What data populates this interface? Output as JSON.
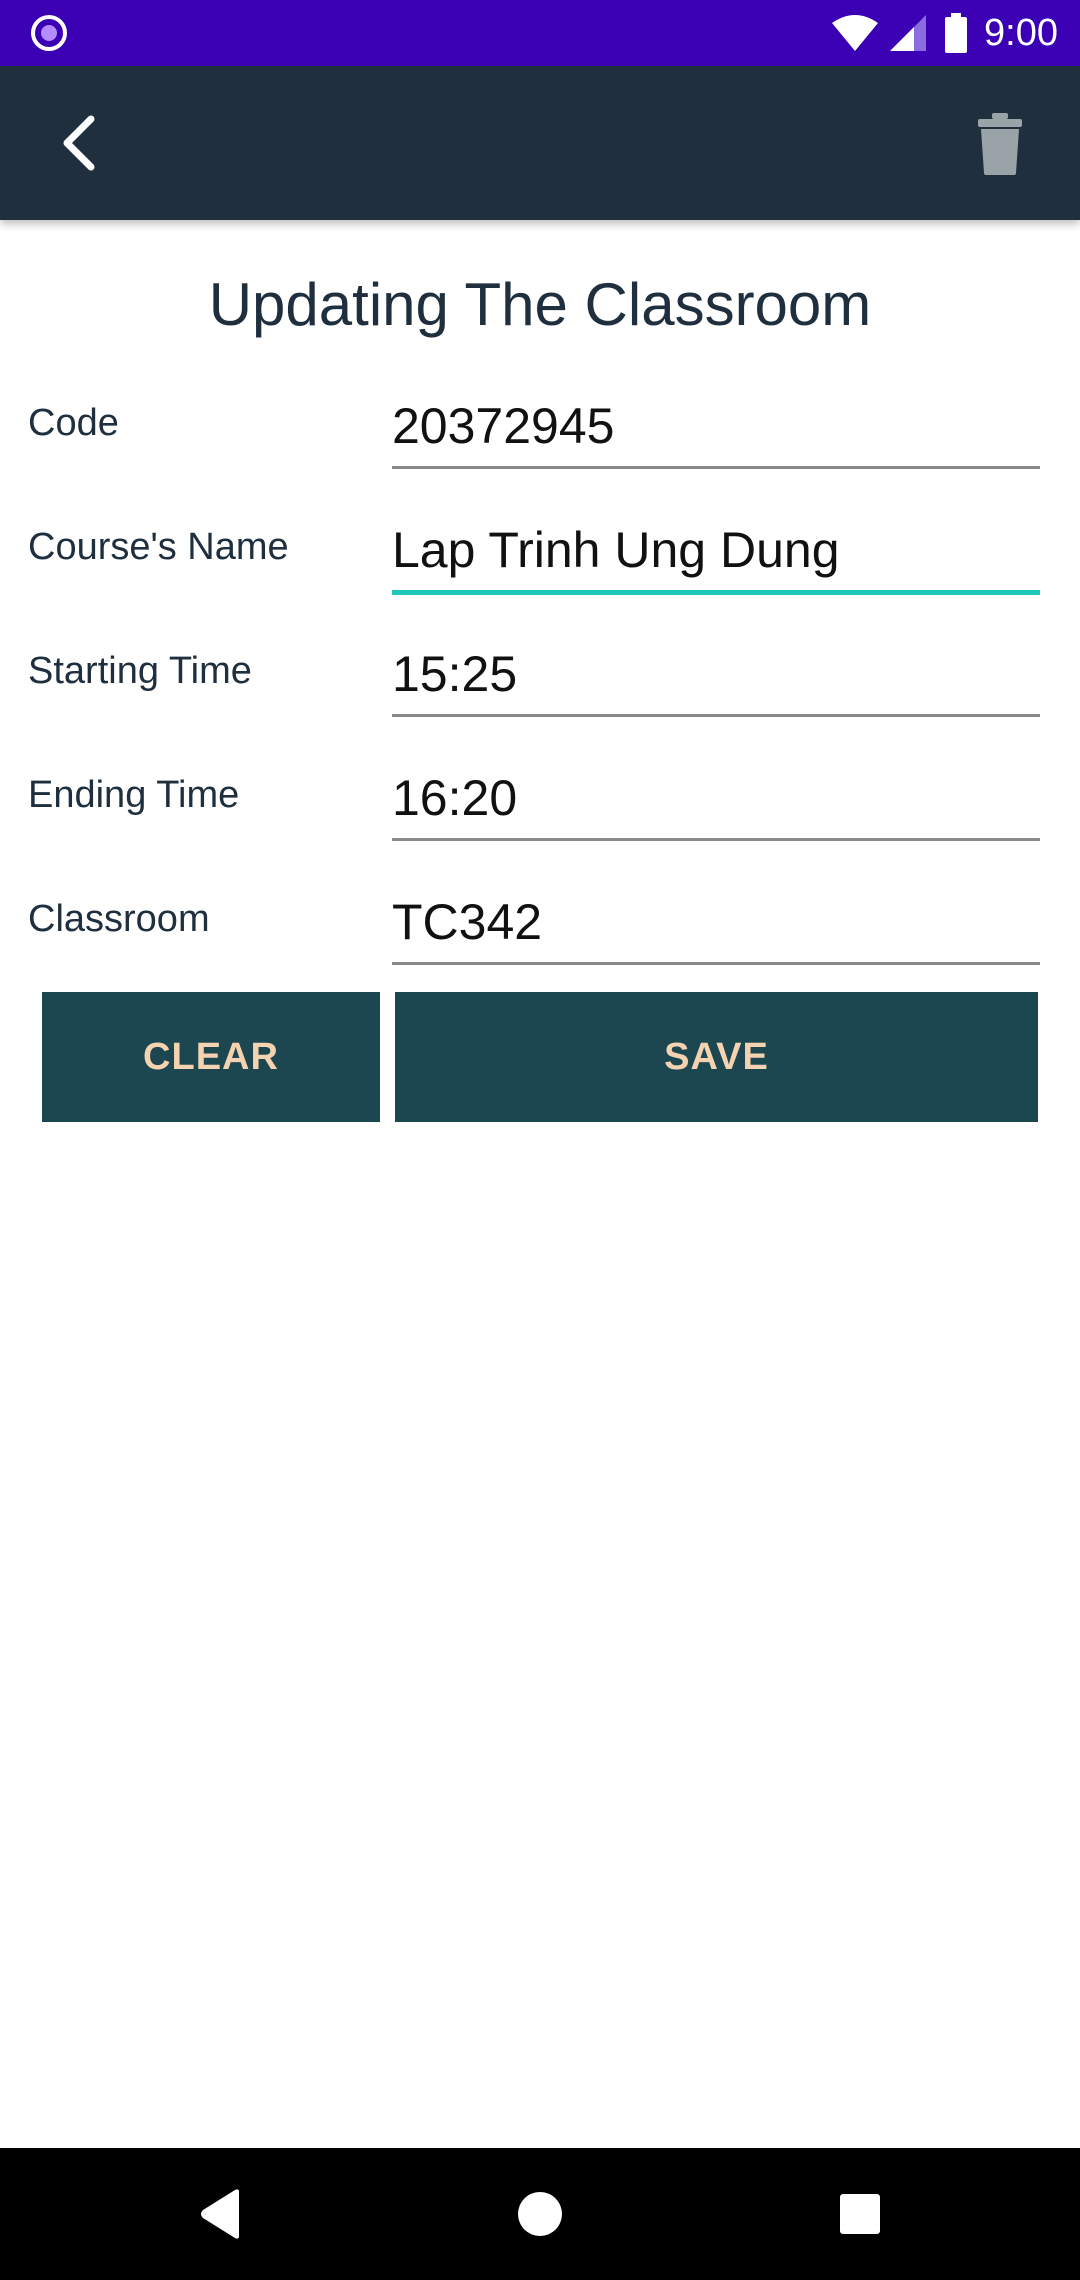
{
  "status_bar": {
    "time": "9:00",
    "icons": [
      "notification-dot-icon",
      "wifi-icon",
      "cell-signal-icon",
      "battery-icon"
    ],
    "background": "#3b00b4"
  },
  "app_bar": {
    "back_icon": "chevron-left-icon",
    "delete_icon": "trash-icon",
    "background": "#1f2f3d"
  },
  "page": {
    "title": "Updating The Classroom"
  },
  "form": {
    "fields": [
      {
        "label": "Code",
        "value": "20372945"
      },
      {
        "label": "Course's Name",
        "value": "Lap Trinh Ung Dung"
      },
      {
        "label": "Starting Time",
        "value": "15:25"
      },
      {
        "label": "Ending Time",
        "value": "16:20"
      },
      {
        "label": "Classroom",
        "value": "TC342"
      }
    ],
    "focused_field": "Course's Name",
    "accent_color": "#1fc7b6"
  },
  "actions": {
    "clear_label": "CLEAR",
    "save_label": "SAVE",
    "button_background": "#1c4650",
    "button_text_color": "#f5d3b0"
  },
  "nav_bar": {
    "icons": [
      "back-triangle-icon",
      "home-circle-icon",
      "recents-square-icon"
    ]
  }
}
